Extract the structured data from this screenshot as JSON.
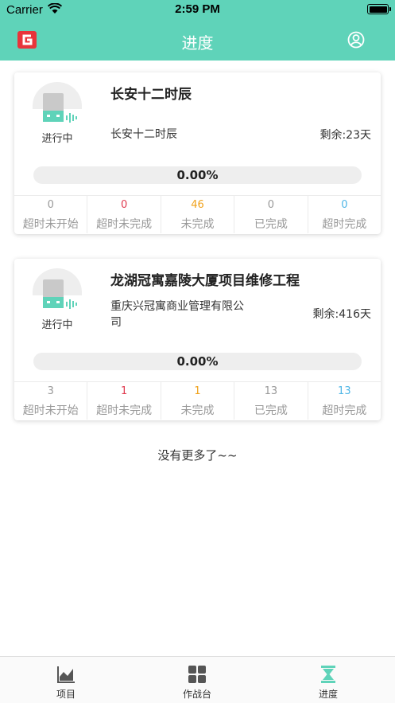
{
  "status_bar": {
    "carrier": "Carrier",
    "time": "2:59 PM"
  },
  "nav": {
    "title": "进度",
    "logo_icon": "brand-logo-icon",
    "user_icon": "user-circle-icon"
  },
  "colors": {
    "header": "#5fd3b9",
    "stat_gray": "#999999",
    "stat_red": "#e03a4f",
    "stat_orange": "#f0a21c",
    "stat_blue": "#4fb6e6",
    "progress_track": "#eeeeee"
  },
  "projects": [
    {
      "state": "进行中",
      "name": "长安十二时辰",
      "company": "长安十二时辰",
      "remaining": "剩余:23天",
      "progress_text": "0.00%",
      "progress": 0.0,
      "stats": [
        {
          "value": "0",
          "label": "超时未开始"
        },
        {
          "value": "0",
          "label": "超时未完成"
        },
        {
          "value": "46",
          "label": "未完成"
        },
        {
          "value": "0",
          "label": "已完成"
        },
        {
          "value": "0",
          "label": "超时完成"
        }
      ]
    },
    {
      "state": "进行中",
      "name": "龙湖冠寓嘉陵大厦项目维修工程",
      "company": "重庆兴冠寓商业管理有限公司",
      "remaining": "剩余:416天",
      "progress_text": "0.00%",
      "progress": 0.0,
      "stats": [
        {
          "value": "3",
          "label": "超时未开始"
        },
        {
          "value": "1",
          "label": "超时未完成"
        },
        {
          "value": "1",
          "label": "未完成"
        },
        {
          "value": "13",
          "label": "已完成"
        },
        {
          "value": "13",
          "label": "超时完成"
        }
      ]
    }
  ],
  "footer_text": "没有更多了~~",
  "tabs": [
    {
      "label": "项目",
      "icon": "chart-icon"
    },
    {
      "label": "作战台",
      "icon": "grid-icon"
    },
    {
      "label": "进度",
      "icon": "hourglass-icon",
      "active": true
    }
  ]
}
